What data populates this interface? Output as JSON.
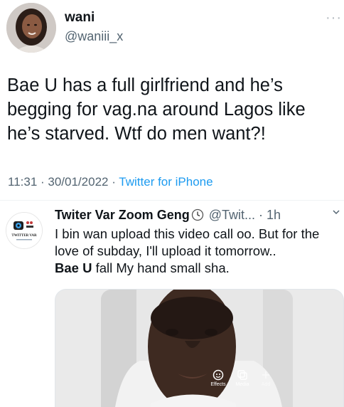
{
  "author": {
    "name": "wani",
    "handle": "@waniii_x"
  },
  "tweet": {
    "text": "Bae U has a full girlfriend and he’s begging for vag.na around Lagos like he’s starved. Wtf do men want?!",
    "time": "11:31",
    "date": "30/01/2022",
    "separator": " · ",
    "source": "Twitter for iPhone"
  },
  "quoted": {
    "name": "Twiter Var Zoom Geng",
    "handle": "@Twit...",
    "age": "1h",
    "dot": "·",
    "text_part1": "I bin wan upload this video call oo. But for the love of subday, I'll upload it tomorrow..",
    "text_bold": "Bae U",
    "text_part2": " fall My hand small sha.",
    "avatar_text": "TWITTER VAR",
    "video_controls": [
      "Effects",
      "Media",
      "Add"
    ]
  },
  "colors": {
    "link": "#1d9bf0",
    "secondary": "#536471"
  },
  "icons": [
    "more-icon",
    "clock-icon",
    "chevron-down-icon",
    "effects-icon",
    "media-icon"
  ]
}
